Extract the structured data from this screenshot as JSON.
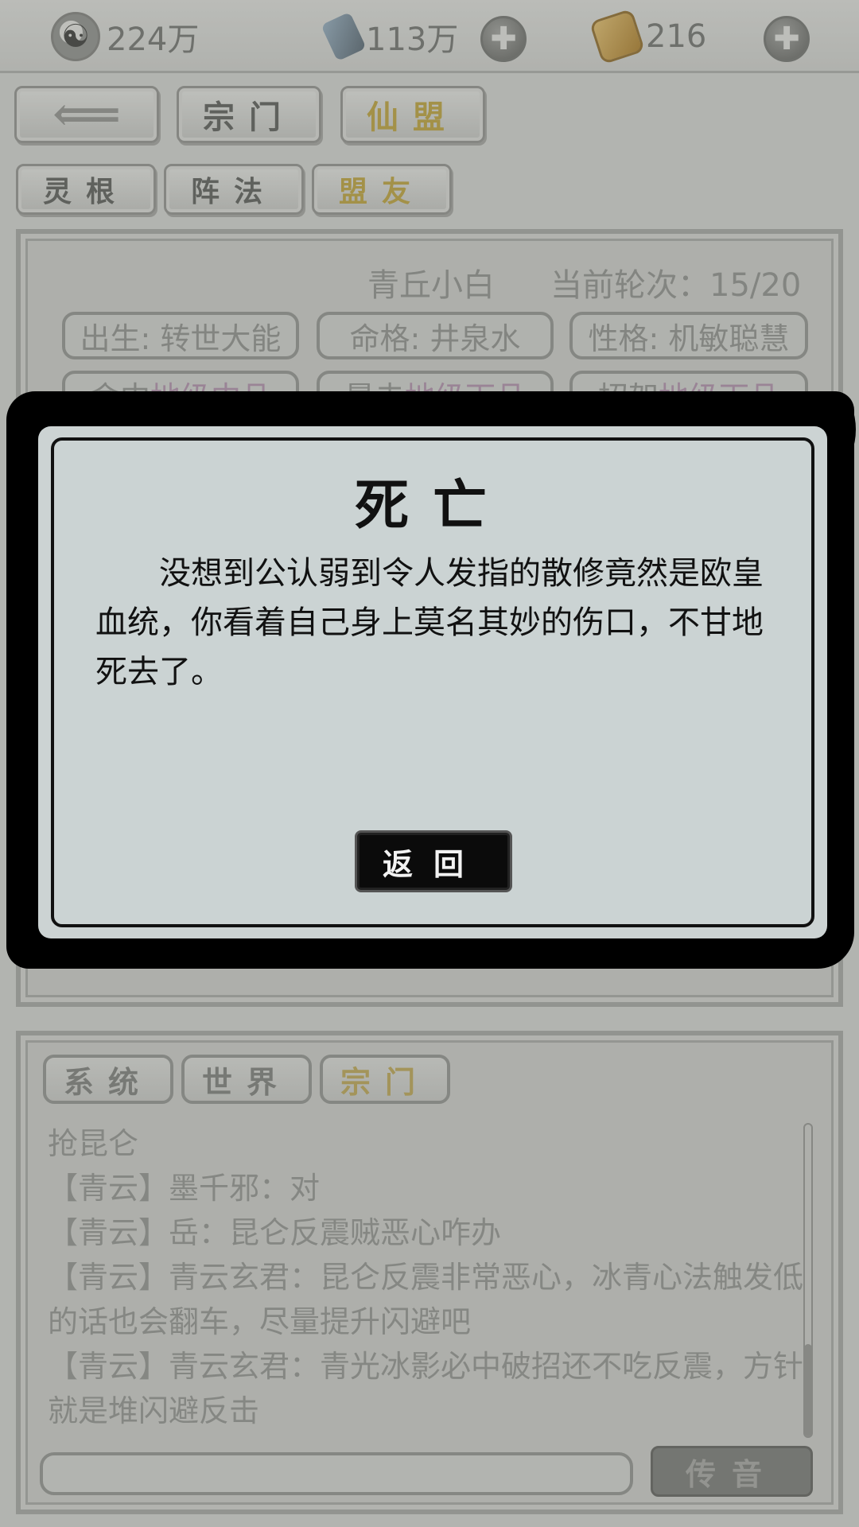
{
  "currency": {
    "spirit_stone": "224万",
    "crystal": "113万",
    "token": "216",
    "yinyang_glyph": "☯",
    "plus_glyph": "✚"
  },
  "nav": {
    "back_glyph": "⟸",
    "sect_label": "宗门",
    "alliance_label": "仙盟"
  },
  "subnav": {
    "root_label": "灵根",
    "formation_label": "阵法",
    "ally_label": "盟友"
  },
  "character": {
    "name": "青丘小白",
    "round_text": "当前轮次：15/20",
    "attrs": [
      {
        "label": "出生: 转世大能"
      },
      {
        "label": "命格:  井泉水"
      },
      {
        "label": "性格: 机敏聪慧"
      }
    ],
    "stats": [
      {
        "prefix": "命中 ",
        "value": "地级中品"
      },
      {
        "prefix": "暴击 ",
        "value": "地级下品"
      },
      {
        "prefix": "招架 ",
        "value": "地级下品"
      }
    ]
  },
  "dialog": {
    "title": "死亡",
    "body": "没想到公认弱到令人发指的散修竟然是欧皇血统，你看着自己身上莫名其妙的伤口，不甘地死去了。",
    "return_label": "返回"
  },
  "chat": {
    "tabs": [
      "系统",
      "世界",
      "宗门"
    ],
    "active_tab": "宗门",
    "messages": [
      "抢昆仑",
      "【青云】墨千邪：对",
      "【青云】岳：昆仑反震贼恶心咋办",
      "【青云】青云玄君：昆仑反震非常恶心，冰青心法触发低的话也会翻车，尽量提升闪避吧",
      "【青云】青云玄君：青光冰影必中破招还不吃反震，方针就是堆闪避反击"
    ],
    "send_label": "传音"
  },
  "colors": {
    "accent_gold": "#b49d3c",
    "dialog_bg": "#cbd3d3",
    "ink": "#000000"
  }
}
